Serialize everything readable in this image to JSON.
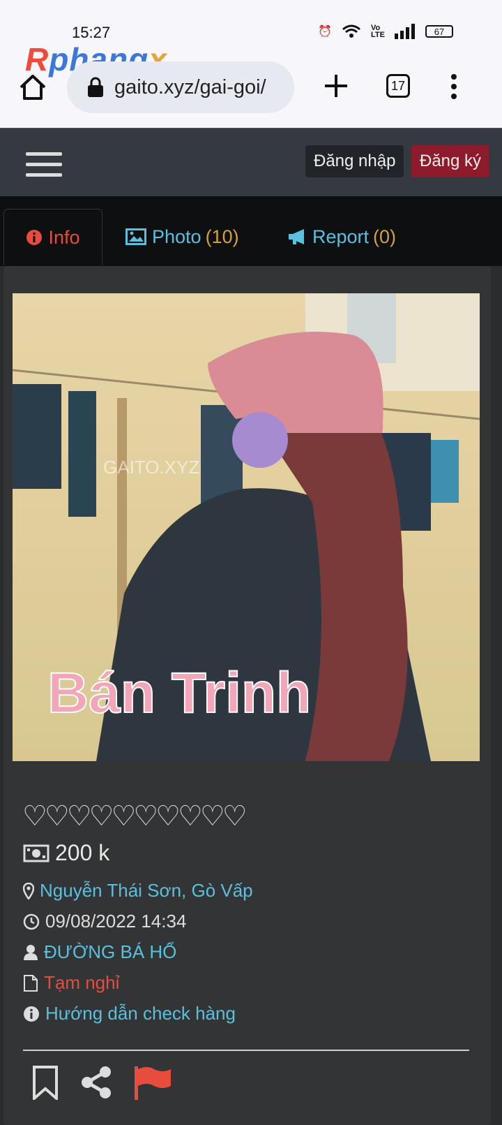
{
  "status_bar": {
    "time": "15:27",
    "battery": "67"
  },
  "watermark": {
    "r": "R",
    "phang": "phang",
    "x": "x"
  },
  "browser": {
    "url": "gaito.xyz/gai-goi/",
    "tab_count": "17"
  },
  "navbar": {
    "login": "Đăng nhập",
    "register": "Đăng ký"
  },
  "tabs": [
    {
      "label": "Info",
      "count": ""
    },
    {
      "label": "Photo",
      "count": "(10)"
    },
    {
      "label": "Report",
      "count": "(0)"
    }
  ],
  "photo": {
    "watermark": "GAITO.XYZ",
    "caption": "Bán Trinh"
  },
  "details": {
    "hearts": "♡♡♡♡♡♡♡♡♡♡",
    "price": "200 k",
    "address": "Nguyễn Thái Sơn, Gò Vấp",
    "date": "09/08/2022 14:34",
    "user": "ĐƯỜNG BÁ HỔ",
    "status": "Tạm nghỉ",
    "guide": "Hướng dẫn check hàng"
  },
  "colors": {
    "link": "#5bc0de",
    "danger": "#e74c3c",
    "register_bg": "#8e1b2b",
    "count": "#d4a13a"
  }
}
